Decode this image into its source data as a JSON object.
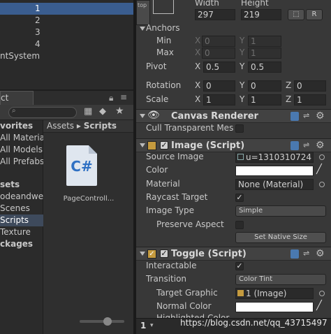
{
  "hierarchy": {
    "rows": [
      "1",
      "2",
      "3",
      "4",
      "ntSystem"
    ]
  },
  "project": {
    "tab_label": "ct",
    "tree": [
      "vorites",
      "All Materials",
      "All Models",
      "All Prefabs",
      "sets",
      "odeandwe",
      "Scenes",
      "Scripts",
      "Texture",
      "ckages"
    ],
    "breadcrumb_root": "Assets",
    "breadcrumb_sep": "▸",
    "breadcrumb_current": "Scripts",
    "file": {
      "icon_text": "C#",
      "name": "PageControll..."
    }
  },
  "inspector": {
    "top_side_text": "top",
    "width_label": "Width",
    "height_label": "Height",
    "width_value": "297",
    "height_value": "219",
    "r_button": "R",
    "anchors_label": "Anchors",
    "min_label": "Min",
    "max_label": "Max",
    "x_label": "X",
    "y_label": "Y",
    "z_label": "Z",
    "anchor_min_x": "0",
    "anchor_min_y": "1",
    "anchor_max_x": "0",
    "anchor_max_y": "1",
    "pivot_label": "Pivot",
    "pivot_x": "0.5",
    "pivot_y": "0.5",
    "rotation_label": "Rotation",
    "rot_x": "0",
    "rot_y": "0",
    "rot_z": "0",
    "scale_label": "Scale",
    "scale_x": "1",
    "scale_y": "1",
    "scale_z": "1",
    "canvas_renderer": {
      "title": "Canvas Renderer",
      "cull_label": "Cull Transparent Mes"
    },
    "image": {
      "title": "Image (Script)",
      "source_label": "Source Image",
      "source_value": "u=1310310724",
      "color_label": "Color",
      "material_label": "Material",
      "material_value": "None (Material)",
      "raycast_label": "Raycast Target",
      "type_label": "Image Type",
      "type_value": "Simple",
      "preserve_label": "Preserve Aspect",
      "native_button": "Set Native Size"
    },
    "toggle": {
      "title": "Toggle (Script)",
      "interactable_label": "Interactable",
      "transition_label": "Transition",
      "transition_value": "Color Tint",
      "target_label": "Target Graphic",
      "target_value": "1 (Image)",
      "normal_label": "Normal Color",
      "highlight_label": "Highlighted Color"
    }
  },
  "status": {
    "page_number": "1",
    "watermark": "https://blog.csdn.net/qq_43715497"
  },
  "colors": {
    "selection": "#3a5d8f",
    "panel": "#383838",
    "header": "#424242"
  }
}
